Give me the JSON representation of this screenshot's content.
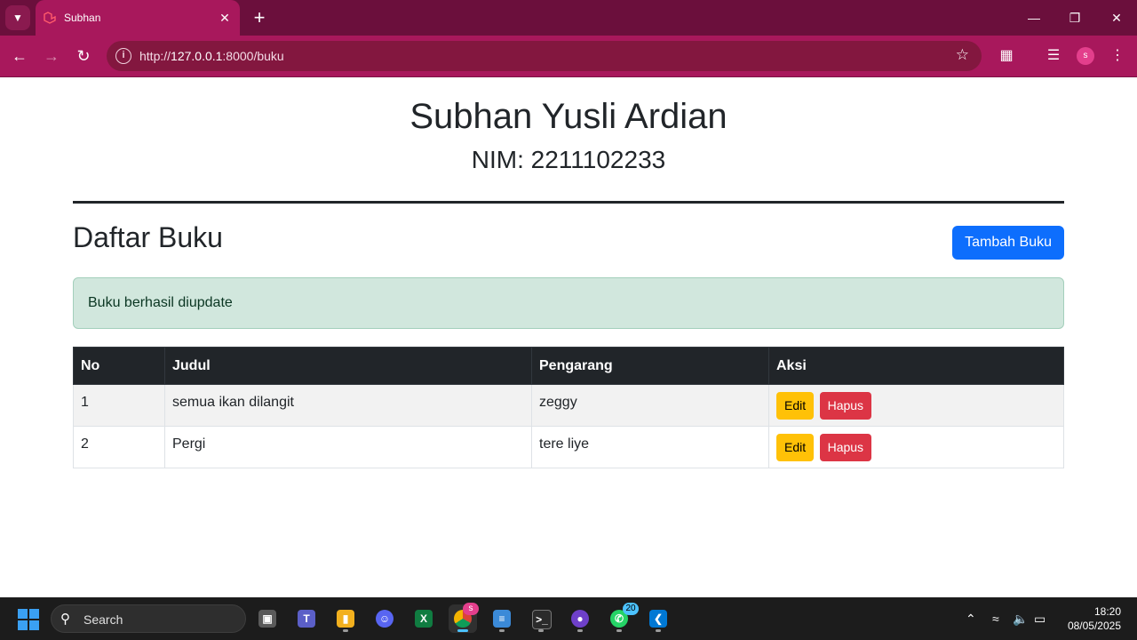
{
  "browser": {
    "tab_title": "Subhan",
    "url_prefix": "http://",
    "url_host": "127.0.0.1",
    "url_path": ":8000/buku",
    "profile_initial": "s"
  },
  "page": {
    "name": "Subhan Yusli Ardian",
    "nim": "NIM: 2211102233",
    "heading": "Daftar Buku",
    "add_button": "Tambah Buku",
    "alert": "Buku berhasil diupdate"
  },
  "table": {
    "headers": [
      "No",
      "Judul",
      "Pengarang",
      "Aksi"
    ],
    "rows": [
      {
        "no": "1",
        "judul": "semua ikan dilangit",
        "pengarang": "zeggy"
      },
      {
        "no": "2",
        "judul": "Pergi",
        "pengarang": "tere liye"
      }
    ],
    "edit_label": "Edit",
    "delete_label": "Hapus"
  },
  "taskbar": {
    "search_label": "Search",
    "chrome_badge": "s",
    "whatsapp_badge": "20",
    "time": "18:20",
    "date": "08/05/2025"
  },
  "colors": {
    "browser_frame": "#a8185c",
    "primary": "#0d6efd",
    "warning": "#ffc107",
    "danger": "#dc3545",
    "alert_bg": "#d1e7dd",
    "table_header": "#212529"
  }
}
